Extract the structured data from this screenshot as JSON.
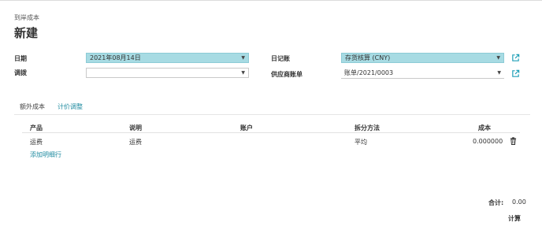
{
  "breadcrumb": "到岸成本",
  "title": "新建",
  "form": {
    "date_label": "日期",
    "date_value": "2021年08月14日",
    "transfer_label": "调拨",
    "transfer_value": "",
    "journal_label": "日记账",
    "journal_value": "存货核算 (CNY)",
    "vendor_bill_label": "供应商账单",
    "vendor_bill_value": "账单/2021/0003"
  },
  "tabs": [
    {
      "label": "额外成本"
    },
    {
      "label": "计价调整"
    }
  ],
  "table": {
    "headers": {
      "product": "产品",
      "description": "说明",
      "account": "账户",
      "split_method": "拆分方法",
      "cost": "成本"
    },
    "rows": [
      {
        "product": "运费",
        "description": "运费",
        "account": "",
        "split_method": "平均",
        "cost": "0.000000"
      }
    ],
    "add_line": "添加明细行"
  },
  "totals": {
    "label": "合计:",
    "value": "0.00"
  },
  "compute_button": "计算",
  "icons": {
    "dropdown": "caret-down-icon",
    "external": "external-link-icon",
    "delete": "trash-icon"
  },
  "colors": {
    "accent": "#1f8ba0",
    "selected_field": "#a7dbe3"
  }
}
